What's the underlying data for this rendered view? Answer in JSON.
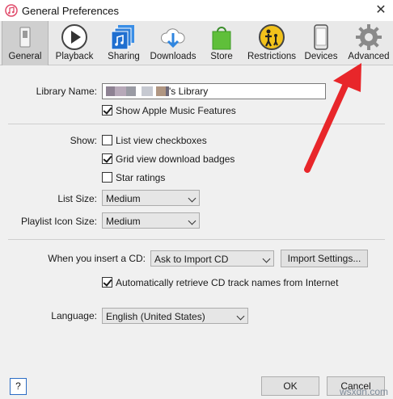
{
  "window": {
    "title": "General Preferences",
    "close_glyph": "✕"
  },
  "toolbar": {
    "tabs": [
      {
        "label": "General",
        "icon": "general-switch-icon",
        "selected": true
      },
      {
        "label": "Playback",
        "icon": "play-icon"
      },
      {
        "label": "Sharing",
        "icon": "sharing-icon"
      },
      {
        "label": "Downloads",
        "icon": "download-cloud-icon"
      },
      {
        "label": "Store",
        "icon": "shopping-bag-icon"
      },
      {
        "label": "Restrictions",
        "icon": "parental-restrictions-icon"
      },
      {
        "label": "Devices",
        "icon": "device-icon"
      },
      {
        "label": "Advanced",
        "icon": "gear-icon"
      }
    ]
  },
  "library": {
    "label": "Library Name:",
    "value_suffix": "'s Library",
    "show_apple_music_label": "Show Apple Music Features",
    "show_apple_music_checked": true
  },
  "show": {
    "label": "Show:",
    "options": [
      {
        "label": "List view checkboxes",
        "checked": false
      },
      {
        "label": "Grid view download badges",
        "checked": true
      },
      {
        "label": "Star ratings",
        "checked": false
      }
    ]
  },
  "list_size": {
    "label": "List Size:",
    "value": "Medium"
  },
  "playlist_icon_size": {
    "label": "Playlist Icon Size:",
    "value": "Medium"
  },
  "cd": {
    "label": "When you insert a CD:",
    "value": "Ask to Import CD",
    "import_settings_label": "Import Settings...",
    "auto_retrieve_label": "Automatically retrieve CD track names from Internet",
    "auto_retrieve_checked": true
  },
  "language": {
    "label": "Language:",
    "value": "English (United States)"
  },
  "footer": {
    "help_label": "?",
    "ok_label": "OK",
    "cancel_label": "Cancel"
  },
  "watermark": "wsxdn.com",
  "colors": {
    "annotation_arrow": "#e8262a",
    "help_border": "#2b6cc4"
  }
}
